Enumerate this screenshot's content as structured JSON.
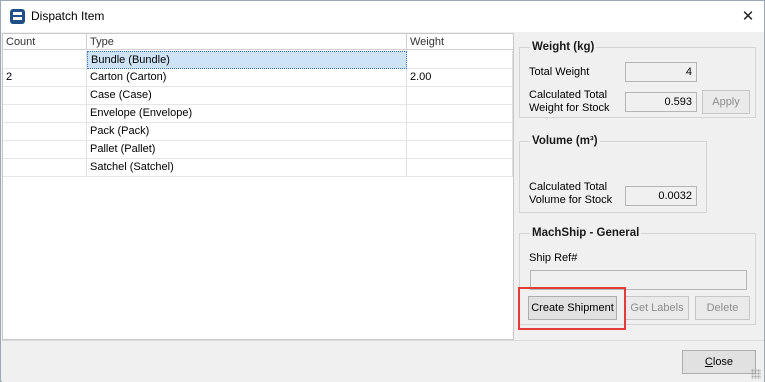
{
  "window": {
    "title": "Dispatch Item",
    "close_glyph": "✕"
  },
  "grid": {
    "columns": [
      "Count",
      "Type",
      "Weight"
    ],
    "rows": [
      {
        "count": "",
        "type": "Bundle (Bundle)",
        "weight": "",
        "selected": true
      },
      {
        "count": "2",
        "type": "Carton (Carton)",
        "weight": "2.00",
        "selected": false
      },
      {
        "count": "",
        "type": "Case (Case)",
        "weight": "",
        "selected": false
      },
      {
        "count": "",
        "type": "Envelope (Envelope)",
        "weight": "",
        "selected": false
      },
      {
        "count": "",
        "type": "Pack (Pack)",
        "weight": "",
        "selected": false
      },
      {
        "count": "",
        "type": "Pallet (Pallet)",
        "weight": "",
        "selected": false
      },
      {
        "count": "",
        "type": "Satchel (Satchel)",
        "weight": "",
        "selected": false
      }
    ]
  },
  "weight_group": {
    "title": "Weight (kg)",
    "total_weight_label": "Total Weight",
    "total_weight_value": "4",
    "calc_label_line1": "Calculated Total",
    "calc_label_line2": "Weight for Stock",
    "calc_value": "0.593",
    "apply_label": "Apply"
  },
  "volume_group": {
    "title": "Volume (m³)",
    "calc_label_line1": "Calculated Total",
    "calc_label_line2": "Volume for Stock",
    "calc_value": "0.0032"
  },
  "machship_group": {
    "title": "MachShip - General",
    "ship_ref_label": "Ship Ref#",
    "ship_ref_value": "",
    "create_label": "Create Shipment",
    "get_labels_label": "Get Labels",
    "delete_label": "Delete"
  },
  "footer": {
    "close_label_first": "C",
    "close_label_rest": "lose"
  },
  "colors": {
    "selection": "#cfe3f7",
    "highlight": "#e33b3b",
    "app_icon": "#1f4f86"
  }
}
